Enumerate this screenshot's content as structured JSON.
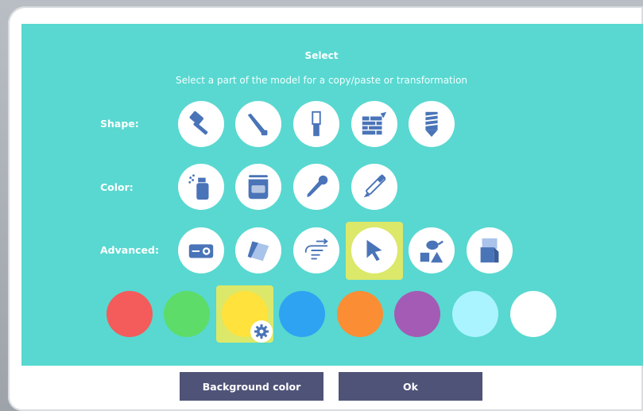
{
  "dialog": {
    "title": "Select",
    "subtitle": "Select a part of the model for a copy/paste or transformation"
  },
  "rows": {
    "shape_label": "Shape:",
    "color_label": "Color:",
    "advanced_label": "Advanced:"
  },
  "shape_tools": [
    "hammer-icon",
    "saw-icon",
    "chisel-icon",
    "brick-wall-icon",
    "drill-bit-icon"
  ],
  "color_tools": [
    "spray-can-icon",
    "paint-bucket-icon",
    "eyedropper-icon",
    "pipette-icon"
  ],
  "advanced_tools": [
    "projector-icon",
    "paper-shape-icon",
    "pointing-hand-icon",
    "cursor-arrow-icon",
    "teapot-shapes-icon",
    "stacked-cubes-icon"
  ],
  "selected_advanced_tool": "cursor-arrow-icon",
  "swatches": [
    "#f45b5b",
    "#5ddc6a",
    "#ffe23c",
    "#2ea3f2",
    "#fb8d34",
    "#a45bb5",
    "#a9f4ff",
    "#ffffff"
  ],
  "selected_swatch": "#ffe23c",
  "colors": {
    "panel": "#58d8d0",
    "icon_blue": "#4a74b8",
    "selection_highlight": "#dbe86a",
    "button": "#4f5378"
  },
  "buttons": {
    "background_color": "Background color",
    "ok": "Ok"
  }
}
